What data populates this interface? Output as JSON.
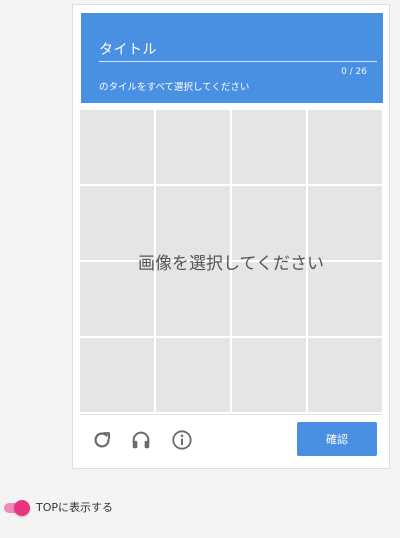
{
  "captcha": {
    "title": "タイトル",
    "counter": "0 / 26",
    "instruction": "のタイルをすべて選択してください",
    "overlay_text": "画像を選択してください",
    "tile_count": 16,
    "confirm_label": "確認",
    "icons": {
      "reload": "reload-icon",
      "audio": "headphones-icon",
      "info": "info-icon"
    },
    "colors": {
      "header": "#4a90e2",
      "tile": "#e5e5e5",
      "button": "#4a90e2"
    }
  },
  "toggle": {
    "label": "TOPに表示する",
    "checked": true,
    "color": "#e8357f"
  }
}
